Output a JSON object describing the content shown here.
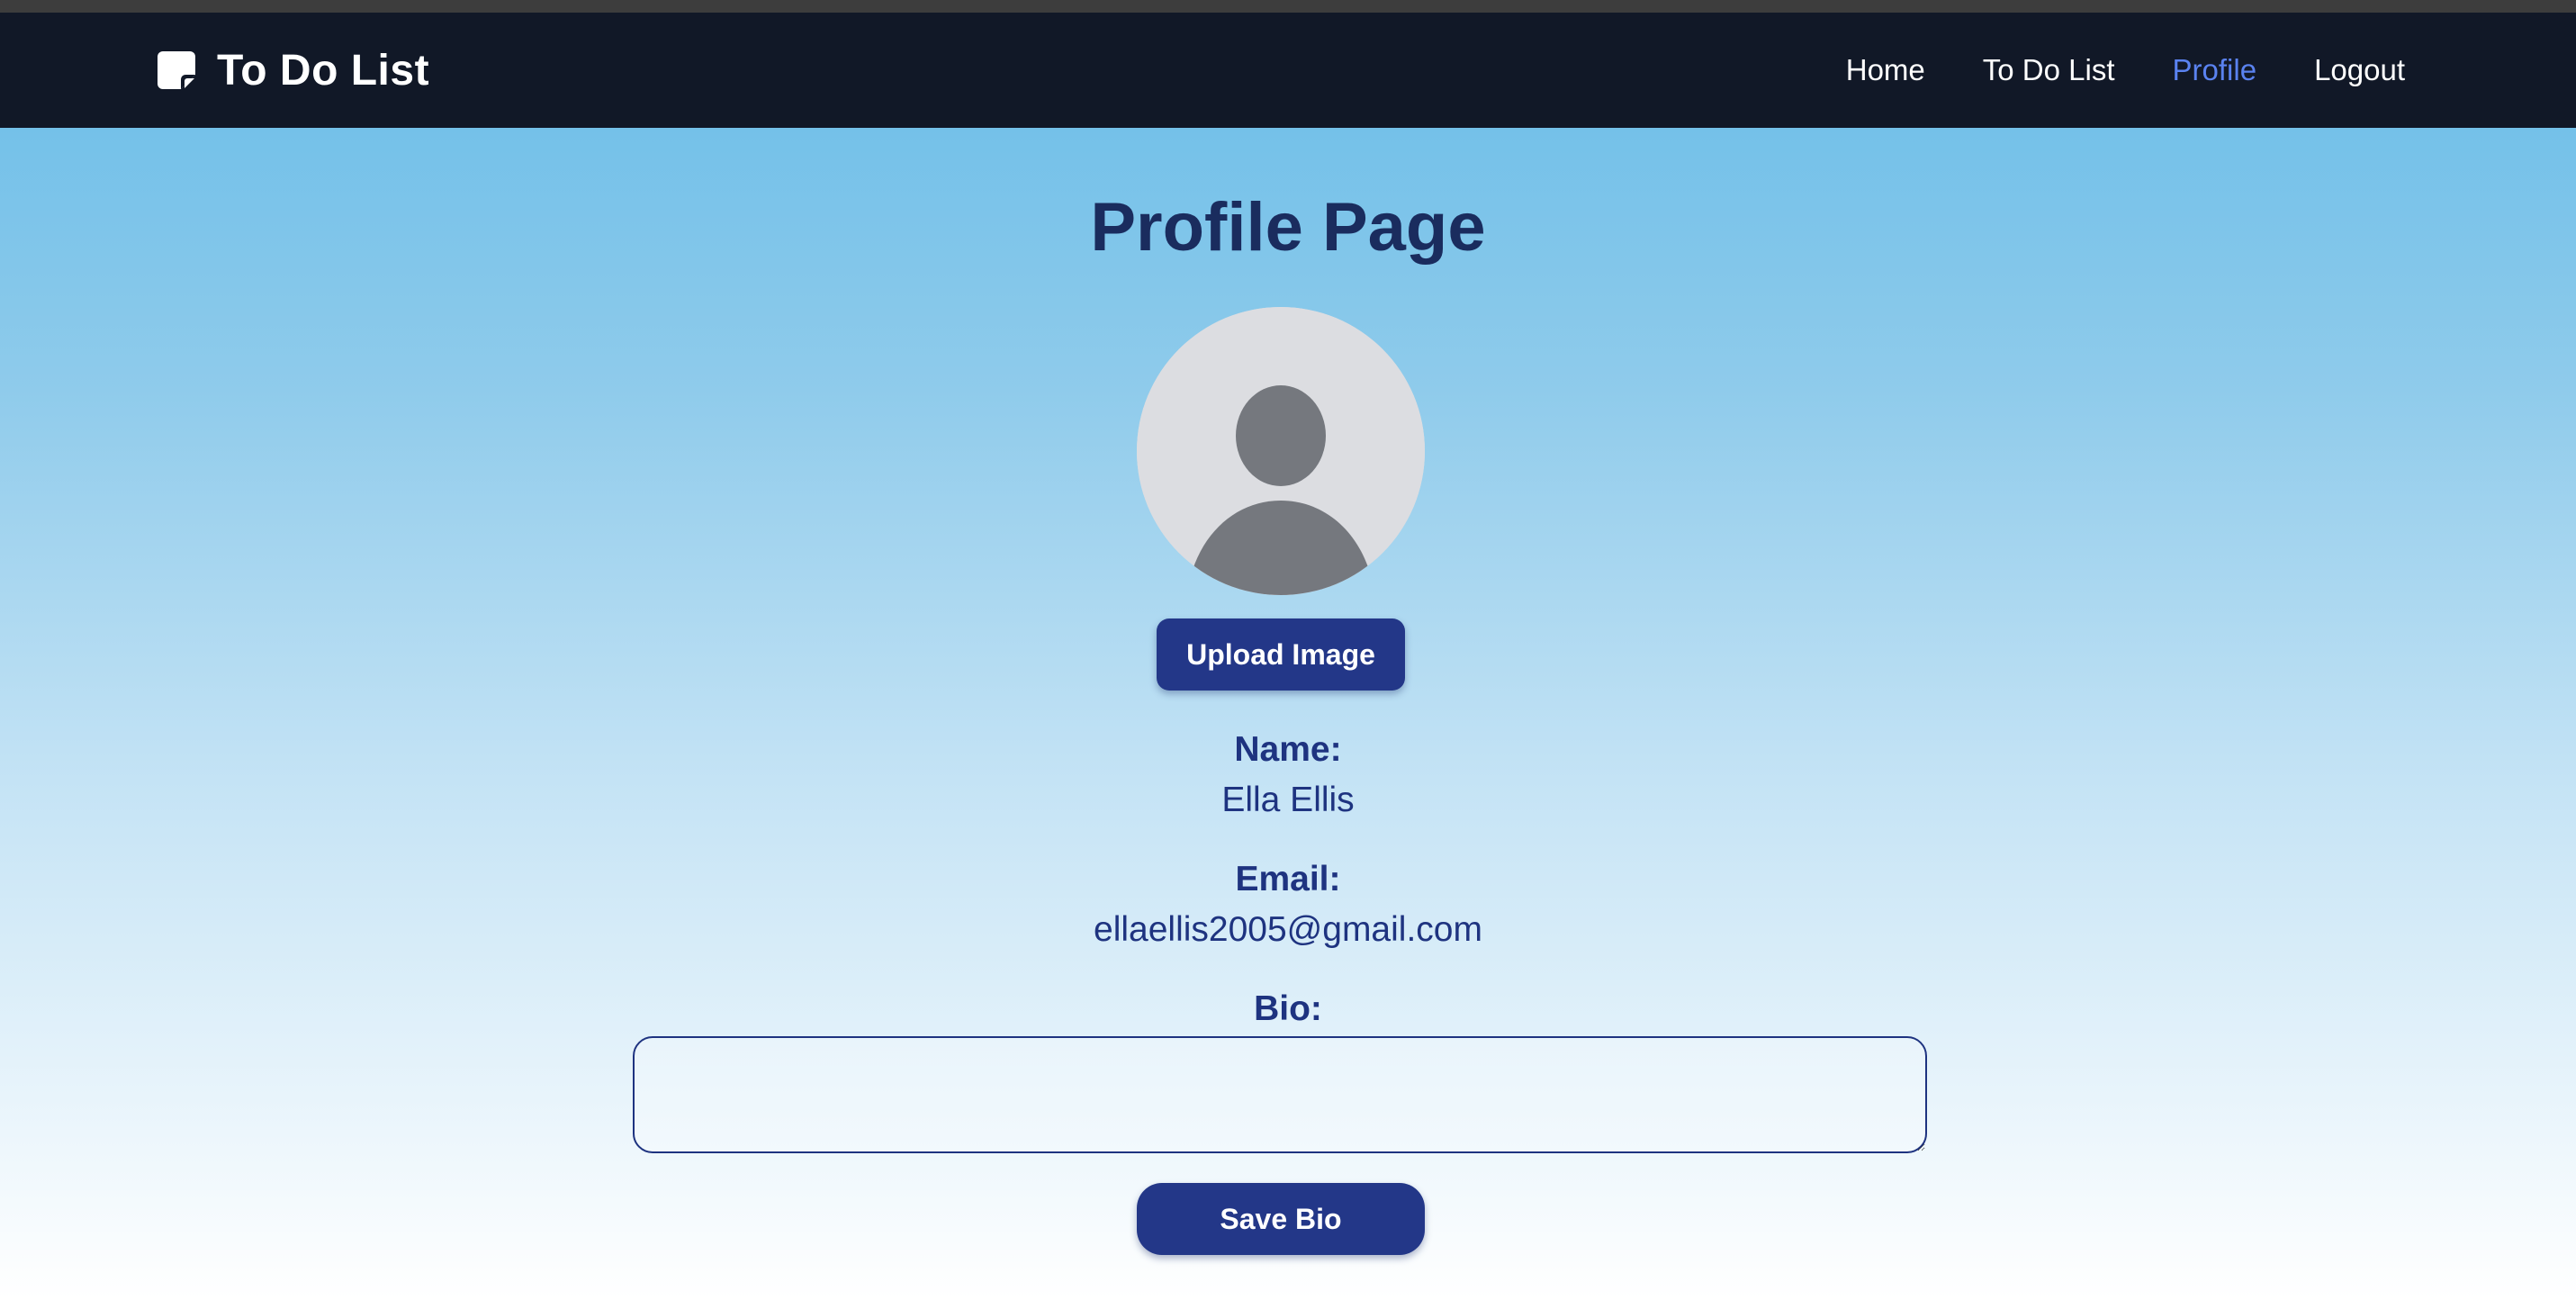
{
  "brand": {
    "title": "To Do List",
    "icon": "sticky-note-icon"
  },
  "nav": {
    "items": [
      {
        "label": "Home",
        "active": false
      },
      {
        "label": "To Do List",
        "active": false
      },
      {
        "label": "Profile",
        "active": true
      },
      {
        "label": "Logout",
        "active": false
      }
    ],
    "active_color": "#5a82f0"
  },
  "profile": {
    "page_title": "Profile Page",
    "avatar_icon": "user-avatar-icon",
    "upload_label": "Upload Image",
    "name_label": "Name:",
    "name_value": "Ella Ellis",
    "email_label": "Email:",
    "email_value": "ellaellis2005@gmail.com",
    "bio_label": "Bio:",
    "bio_value": "",
    "save_label": "Save Bio"
  },
  "colors": {
    "navbar_bg": "#111827",
    "button_bg": "#233788",
    "heading_text": "#1a2c5e",
    "label_text": "#1e3380"
  }
}
